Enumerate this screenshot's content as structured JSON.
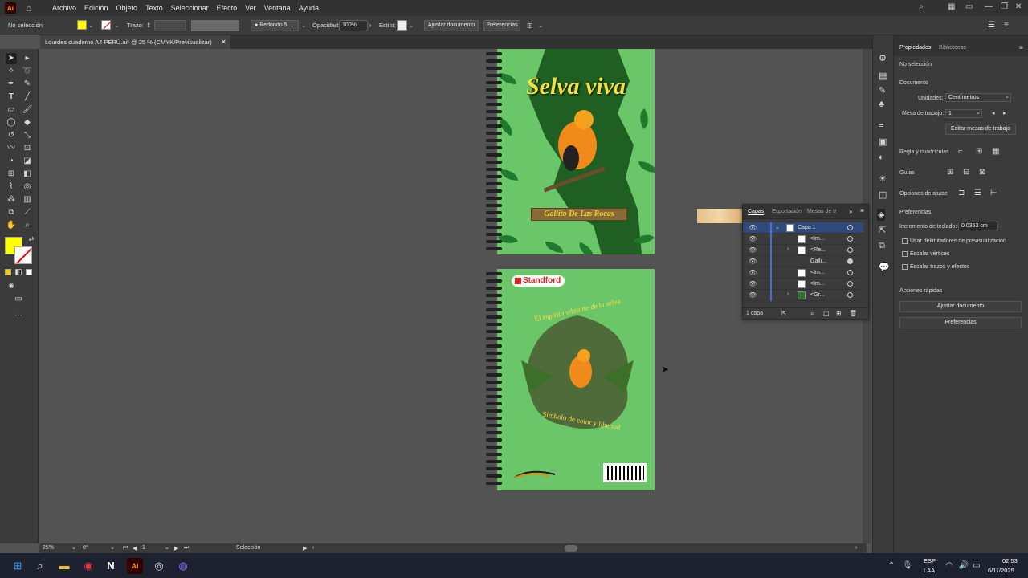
{
  "menubar": {
    "app_icon": "Ai",
    "items": [
      "Archivo",
      "Edición",
      "Objeto",
      "Texto",
      "Seleccionar",
      "Efecto",
      "Ver",
      "Ventana",
      "Ayuda"
    ]
  },
  "control_bar": {
    "selection_state": "No selección",
    "stroke_label": "Trazo:",
    "brush_value": "Redondo 5 ...",
    "opacity_label": "Opacidad:",
    "opacity_value": "100%",
    "style_label": "Estilo:",
    "fit_document": "Ajustar documento",
    "preferences": "Preferencias",
    "fill_color": "#ffff00"
  },
  "document_tab": {
    "title": "Lourdes cuaderno A4 PERÚ.ai* @ 25 % (CMYK/Previsualizar)",
    "close": "×"
  },
  "artwork": {
    "front_title": "Selva viva",
    "front_subtitle": "Gallito De Las Rocas",
    "back_brand": "Standford",
    "back_top_text": "El espíritu vibrante de la selva",
    "back_bottom_text": "Símbolo de color y libertad",
    "cover_green": "#6bc66a",
    "dark_green": "#1f5f22"
  },
  "layers_panel": {
    "tabs": [
      "Capas",
      "Exportación",
      "Mesas de tr"
    ],
    "rows": [
      {
        "name": "Capa 1",
        "expanded": true,
        "selected": true
      },
      {
        "name": "<Im...",
        "expanded": false
      },
      {
        "name": "<Re...",
        "expanded": false,
        "has_children": true
      },
      {
        "name": "Galli...",
        "expanded": false
      },
      {
        "name": "<Im...",
        "expanded": false
      },
      {
        "name": "<Im...",
        "expanded": false
      },
      {
        "name": "<Gr...",
        "expanded": false,
        "has_children": true
      }
    ],
    "footer": "1 capa"
  },
  "properties_panel": {
    "tabs": [
      "Propiedades",
      "Bibliotecas"
    ],
    "selection": "No selección",
    "document_heading": "Documento",
    "units_label": "Unidades:",
    "units_value": "Centímetros",
    "artboard_label": "Mesa de trabajo:",
    "artboard_value": "1",
    "edit_artboards": "Editar mesas de trabajo",
    "rulers_grids": "Regla y cuadrículas",
    "guides": "Guías",
    "snap_options": "Opciones de ajuste",
    "preferences_heading": "Preferencias",
    "keyboard_inc_label": "Incremento de teclado:",
    "keyboard_inc_value": "0.0353 cm",
    "cb_preview_bounds": "Usar delimitadores de previsualización",
    "cb_scale_corners": "Escalar vértices",
    "cb_scale_strokes": "Escalar trazos y efectos",
    "quick_actions": "Acciones rápidas",
    "btn_fit_document": "Ajustar documento",
    "btn_preferences": "Preferencias"
  },
  "statusbar": {
    "zoom": "25%",
    "rotation": "0°",
    "artboard": "1",
    "tool": "Selección"
  },
  "taskbar": {
    "lang": "ESP",
    "lang2": "LAA",
    "time": "02:53",
    "date": "6/11/2025"
  }
}
